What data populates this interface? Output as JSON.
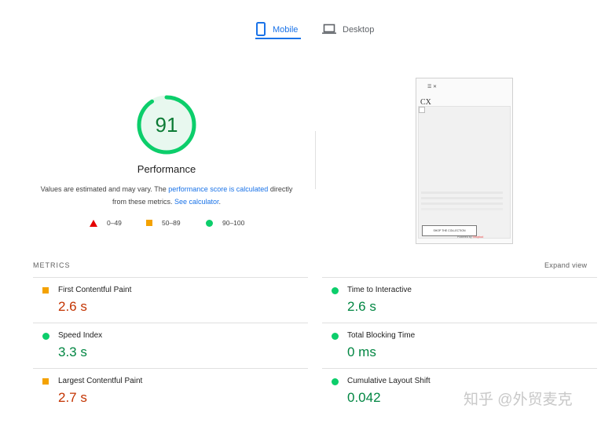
{
  "tabs": {
    "mobile": {
      "label": "Mobile",
      "icon": "phone-icon",
      "active": true
    },
    "desktop": {
      "label": "Desktop",
      "icon": "laptop-icon",
      "active": false
    }
  },
  "performance": {
    "score": "91",
    "score_value": 91,
    "title": "Performance",
    "description_prefix": "Values are estimated and may vary. The ",
    "description_link": "performance score is calculated",
    "description_mid": " directly from these metrics. ",
    "calculator_link": "See calculator",
    "description_suffix": ".",
    "colors": {
      "pass": "#0cce6b",
      "pass_text": "#0c7b35",
      "average": "#f4a200",
      "fail": "#e50000"
    }
  },
  "legend": [
    {
      "range": "0–49",
      "shape": "triangle",
      "color": "#e50000"
    },
    {
      "range": "50–89",
      "shape": "square",
      "color": "#f4a200"
    },
    {
      "range": "90–100",
      "shape": "circle",
      "color": "#0cce6b"
    }
  ],
  "screenshot": {
    "header": "☰ ✕",
    "logo": "CX",
    "button": "SHOP THE COLLECTION",
    "powered_prefix": "Powered by",
    "powered_brand": "Shoptool"
  },
  "metrics": {
    "header": "METRICS",
    "expand": "Expand view",
    "items": [
      {
        "name": "First Contentful Paint",
        "value": "2.6 s",
        "status": "average"
      },
      {
        "name": "Time to Interactive",
        "value": "2.6 s",
        "status": "pass"
      },
      {
        "name": "Speed Index",
        "value": "3.3 s",
        "status": "pass"
      },
      {
        "name": "Total Blocking Time",
        "value": "0 ms",
        "status": "pass"
      },
      {
        "name": "Largest Contentful Paint",
        "value": "2.7 s",
        "status": "average"
      },
      {
        "name": "Cumulative Layout Shift",
        "value": "0.042",
        "status": "pass"
      }
    ]
  },
  "watermark": "知乎 @外贸麦克"
}
